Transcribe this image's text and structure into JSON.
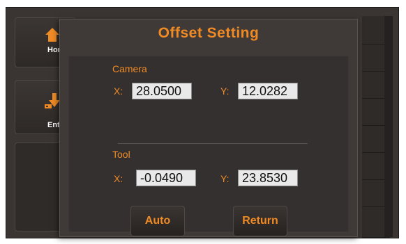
{
  "sidebar": {
    "items": [
      {
        "label": "Home",
        "icon": "home-icon"
      },
      {
        "label": "Enter",
        "icon": "download-icon"
      }
    ]
  },
  "dialog": {
    "title": "Offset Setting",
    "camera": {
      "label": "Camera",
      "x_label": "X:",
      "x_value": "28.0500",
      "y_label": "Y:",
      "y_value": "12.0282"
    },
    "tool": {
      "label": "Tool",
      "x_label": "X:",
      "x_value": "-0.0490",
      "y_label": "Y:",
      "y_value": "23.8530"
    },
    "buttons": {
      "auto": "Auto",
      "return": "Return"
    }
  },
  "colors": {
    "accent": "#f08a24",
    "background": "#3a3532",
    "field": "#e9e9e9"
  }
}
